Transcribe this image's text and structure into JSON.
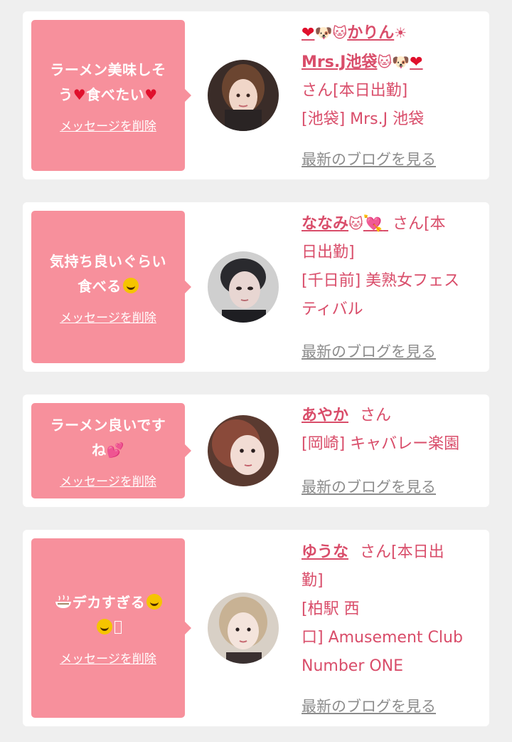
{
  "items": [
    {
      "message_line1": "ラーメン美味しそ",
      "message_line2_a": "う",
      "message_line2_b": "食べたい",
      "delete_label": "メッセージを削除",
      "name_line1": "かりん",
      "name_line2": "Mrs.J池袋",
      "suffix": "さん[本日出勤]",
      "shop": "[池袋] Mrs.J 池袋",
      "blog_label": "最新のブログを見る"
    },
    {
      "message_line1": "気持ち良いぐらい",
      "message_line2": "食べる",
      "delete_label": "メッセージを削除",
      "name": "ななみ",
      "suffix_line1": "さん[本",
      "suffix_line2": "日出勤]",
      "shop_line1": "[千日前] 美熟女フェス",
      "shop_line2": "ティバル",
      "blog_label": "最新のブログを見る"
    },
    {
      "message_line1": "ラーメン良いです",
      "message_line2": "ね",
      "delete_label": "メッセージを削除",
      "name": "あやか",
      "suffix": "さん",
      "shop": "[岡崎] キャバレー楽園",
      "blog_label": "最新のブログを見る"
    },
    {
      "message_line1": "デカすぎる",
      "message_line2": "",
      "delete_label": "メッセージを削除",
      "name": "ゆうな",
      "suffix_line1": "さん[本日出",
      "suffix_line2": "勤]",
      "shop_line1": "[柏駅 西",
      "shop_line2": "口] Amusement Club",
      "shop_line3": "Number ONE",
      "blog_label": "最新のブログを見る"
    }
  ],
  "colors": {
    "bubble": "#f7909c",
    "accent": "#d94d6a",
    "link_gray": "#8c8c8c",
    "background": "#efefef"
  }
}
